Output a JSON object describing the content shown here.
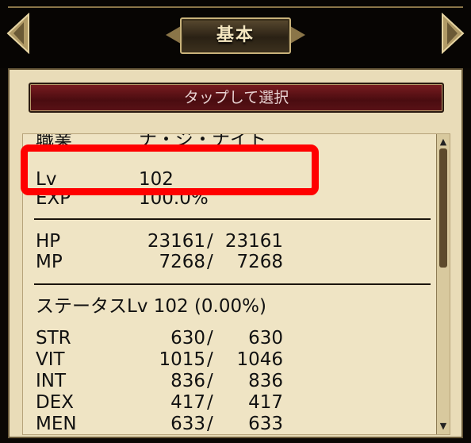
{
  "header": {
    "title": "基本"
  },
  "panel": {
    "select_button_label": "タップして選択"
  },
  "profile": {
    "job": {
      "label": "職業",
      "value": "ナ・ジ・ナイト"
    },
    "lv": {
      "label": "Lv",
      "value": "102"
    },
    "exp": {
      "label": "EXP",
      "value": "100.0%"
    }
  },
  "vitals": {
    "hp": {
      "label": "HP",
      "current": "23161",
      "max": "23161"
    },
    "mp": {
      "label": "MP",
      "current": "7268",
      "max": "7268"
    }
  },
  "status": {
    "heading": "ステータスLv 102 (0.00%)",
    "stats": [
      {
        "label": "STR",
        "current": "630",
        "max": "630"
      },
      {
        "label": "VIT",
        "current": "1015",
        "max": "1046"
      },
      {
        "label": "INT",
        "current": "836",
        "max": "836"
      },
      {
        "label": "DEX",
        "current": "417",
        "max": "417"
      },
      {
        "label": "MEN",
        "current": "633",
        "max": "633"
      }
    ]
  },
  "slash": "/",
  "colors": {
    "highlight": "#ff0000",
    "button": "#5a1216",
    "parchment": "#efe4c4"
  }
}
